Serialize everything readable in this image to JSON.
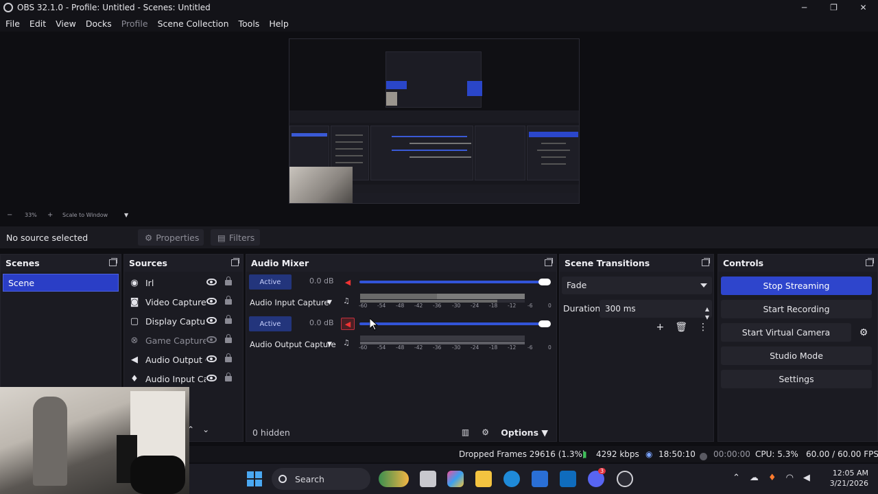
{
  "window": {
    "title": "OBS 32.1.0 - Profile: Untitled - Scenes: Untitled",
    "controls": [
      "─",
      "❐",
      "✕"
    ]
  },
  "menu": {
    "items": [
      "File",
      "Edit",
      "View",
      "Docks",
      "Profile",
      "Scene Collection",
      "Tools",
      "Help"
    ]
  },
  "preview": {
    "zoom": "33%",
    "zoom_minus": "−",
    "zoom_plus": "+",
    "scale_mode": "Scale to Window"
  },
  "source_toolbar": {
    "status": "No source selected",
    "properties_label": "Properties",
    "filters_label": "Filters"
  },
  "scenes": {
    "title": "Scenes",
    "items": [
      "Scene"
    ]
  },
  "sources": {
    "title": "Sources",
    "items": [
      {
        "label": "Irl",
        "icon": "globe-icon"
      },
      {
        "label": "Video Capture Device",
        "icon": "camera-icon"
      },
      {
        "label": "Display Capture",
        "icon": "monitor-icon"
      },
      {
        "label": "Game Capture",
        "icon": "gamepad-icon"
      },
      {
        "label": "Audio Output Capture",
        "icon": "speaker-icon"
      },
      {
        "label": "Audio Input Capture",
        "icon": "microphone-icon"
      }
    ]
  },
  "audio_mixer": {
    "title": "Audio Mixer",
    "channels": [
      {
        "status": "Active",
        "db": "0.0 dB",
        "name": "Audio Input Capture",
        "volume": 1.0
      },
      {
        "status": "Active",
        "db": "0.0 dB",
        "name": "Audio Output Capture",
        "volume": 1.0
      }
    ],
    "scale": [
      "-60",
      "-54",
      "-48",
      "-42",
      "-36",
      "-30",
      "-24",
      "-18",
      "-12",
      "-6",
      "0"
    ],
    "hidden_count": "0 hidden",
    "options_label": "Options"
  },
  "scene_transitions": {
    "title": "Scene Transitions",
    "selected": "Fade",
    "duration_label": "Duration",
    "duration_value": "300 ms"
  },
  "controls": {
    "title": "Controls",
    "stop_streaming": "Stop Streaming",
    "start_recording": "Start Recording",
    "start_virtual_camera": "Start Virtual Camera",
    "studio_mode": "Studio Mode",
    "settings": "Settings",
    "accent": "#2e45cc"
  },
  "status": {
    "dropped_frames": "Dropped Frames 29616 (1.3%)",
    "bitrate": "4292 kbps",
    "stream_time": "18:50:10",
    "record_time": "00:00:00",
    "cpu": "CPU: 5.3%",
    "fps": "60.00 / 60.00 FPS"
  },
  "taskbar": {
    "search_label": "Search",
    "time": "12:05 AM",
    "date": "3/21/2026",
    "badge": "3"
  }
}
